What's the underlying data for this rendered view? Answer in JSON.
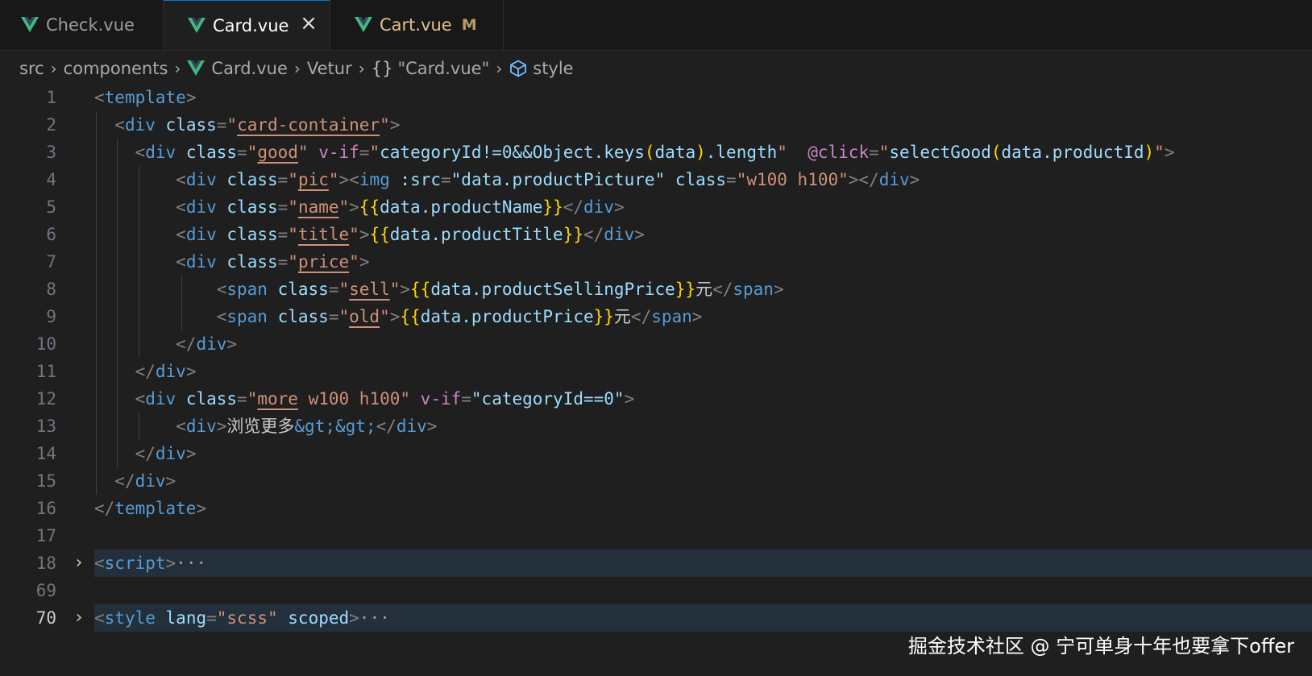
{
  "tabs": [
    {
      "label": "Check.vue",
      "active": false
    },
    {
      "label": "Card.vue",
      "active": true
    },
    {
      "label": "Cart.vue",
      "active": false,
      "modified_badge": "M"
    }
  ],
  "breadcrumb": {
    "items": [
      "src",
      "components",
      "Card.vue",
      "Vetur",
      "\"Card.vue\"",
      "style"
    ],
    "braces": "{}"
  },
  "editor": {
    "line_numbers": [
      "1",
      "2",
      "3",
      "4",
      "5",
      "6",
      "7",
      "8",
      "9",
      "10",
      "11",
      "12",
      "13",
      "14",
      "15",
      "16",
      "17",
      "18",
      "69",
      "70"
    ],
    "collapsed": {
      "script": "script",
      "style": "style",
      "style_lang_attr": "lang",
      "style_lang_value": "\"scss\"",
      "style_scoped": "scoped",
      "ellipsis": "···"
    },
    "text": {
      "template": "template",
      "div": "div",
      "span": "span",
      "img": "img",
      "class": "class",
      "v_if": "v-if",
      "at_click": "@click",
      "src_attr": ":src",
      "card_container": "card-container",
      "good": "good",
      "category_cond": "categoryId!=0&&Object.keys",
      "data_word": "data",
      "length_tail": ".length",
      "select_good": "selectGood",
      "product_id": "data.productId",
      "pic": "pic",
      "product_picture": "\"data.productPicture\"",
      "w100h100_str": "\"w100 h100\"",
      "name": "name",
      "product_name": "data.productName",
      "title": "title",
      "product_title": "data.productTitle",
      "price": "price",
      "sell": "sell",
      "selling_price": "data.productSellingPrice",
      "yuan": "元",
      "old": "old",
      "product_price": "data.productPrice",
      "more": "more",
      "more_rest": " w100 h100\"",
      "category_zero": "\"categoryId==0\"",
      "browse_more": "浏览更多",
      "gtgt": "&gt;&gt;"
    }
  },
  "watermark": "掘金技术社区 @ 宁可单身十年也要拿下offer",
  "colors": {
    "background": "#1f1f1f",
    "tab_bar": "#181818",
    "tag": "#569cd6",
    "attribute": "#9cdcfe",
    "string": "#ce9178",
    "directive": "#c586c0",
    "bracket": "#ffd700",
    "vue_green": "#41b883",
    "modified": "#e2c08d"
  },
  "icons": [
    "vue-logo-icon",
    "close-icon",
    "chevron-right-icon",
    "braces-icon",
    "cube-icon",
    "fold-chevron-icon"
  ]
}
